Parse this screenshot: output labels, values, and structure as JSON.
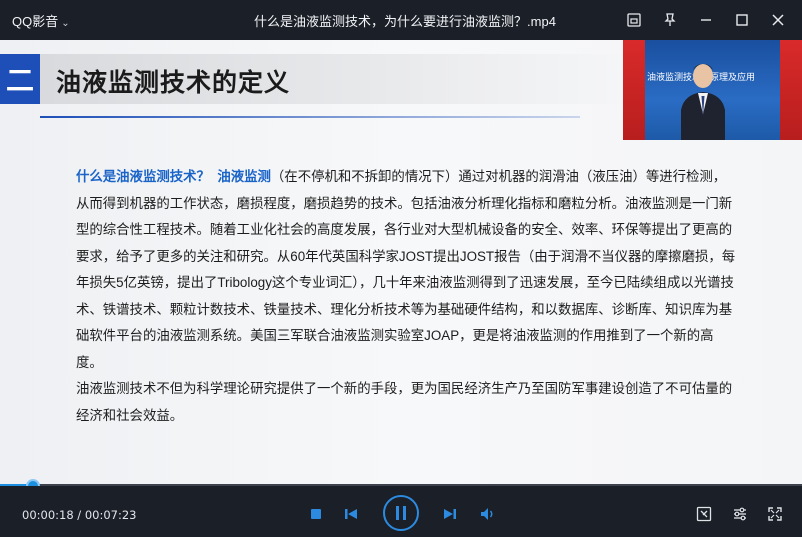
{
  "app": {
    "name": "QQ影音",
    "menu_chevron": "chevron-down-icon"
  },
  "window": {
    "title": "什么是油液监测技术，为什么要进行油液监测？.mp4"
  },
  "titlebar_icons": [
    "screenshot-icon",
    "pin-icon",
    "minimize-icon",
    "maximize-icon",
    "close-icon"
  ],
  "slide": {
    "number": "二",
    "title": "油液监测技术的定义",
    "accent_color": "#1e4fb8",
    "highlight_question": "什么是油液监测技术？",
    "highlight_term": "油液监测",
    "paragraph1_rest": "（在不停机和不拆卸的情况下）通过对机器的润滑油（液压油）等进行检测，从而得到机器的工作状态，磨损程度，磨损趋势的技术。包括油液分析理化指标和磨粒分析。油液监测是一门新型的综合性工程技术。随着工业化社会的高度发展，各行业对大型机械设备的安全、效率、环保等提出了更高的要求，给予了更多的关注和研究。从60年代英国科学家JOST提出JOST报告（由于润滑不当仪器的摩擦磨损，每年损失5亿英镑，提出了Tribology这个专业词汇），几十年来油液监测得到了迅速发展，至今已陆续组成以光谱技术、铁谱技术、颗粒计数技术、铁量技术、理化分析技术等为基础硬件结构，和以数据库、诊断库、知识库为基础软件平台的油液监测系统。美国三军联合油液监测实验室JOAP，更是将油液监测的作用推到了一个新的高度。",
    "paragraph2": "油液监测技术不但为科学理论研究提供了一个新的手段，更为国民经济生产乃至国防军事建设创造了不可估量的经济和社会效益。"
  },
  "speaker_overlay": {
    "banner": "油液监测技术的原理及应用",
    "flag_color": "#d92a2a"
  },
  "player": {
    "current_time": "00:00:18",
    "separator": " / ",
    "total_time": "00:07:23",
    "progress_fraction": 0.041,
    "accent_color": "#1d8fe0",
    "buttons": [
      "stop-icon",
      "previous-icon",
      "pause-icon",
      "next-icon",
      "volume-icon",
      "screenshot-icon",
      "settings-icon",
      "fullscreen-icon"
    ]
  }
}
